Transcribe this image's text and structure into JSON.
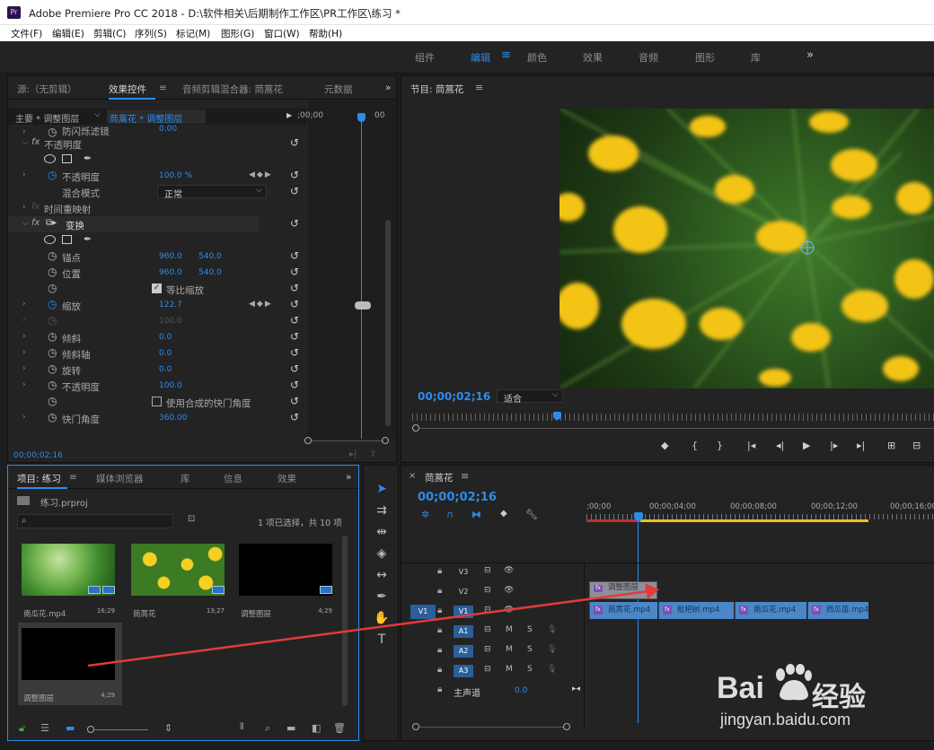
{
  "window": {
    "title": "Adobe Premiere Pro CC 2018 - D:\\软件相关\\后期制作工作区\\PR工作区\\练习 *",
    "app_icon": "Pr"
  },
  "menu": [
    "文件(F)",
    "编辑(E)",
    "剪辑(C)",
    "序列(S)",
    "标记(M)",
    "图形(G)",
    "窗口(W)",
    "帮助(H)"
  ],
  "workspaces": {
    "items": [
      "组件",
      "编辑",
      "颜色",
      "效果",
      "音频",
      "图形",
      "库"
    ],
    "active": "编辑",
    "more": "»"
  },
  "effect_panel": {
    "tabs": [
      "源:（无剪辑）",
      "效果控件",
      "音频剪辑混合器: 茼蒿花",
      "元数据"
    ],
    "master": "主要 * 调整图层",
    "clip": "茼蒿花 * 调整图层",
    "tl_time0": ";00;00",
    "tl_time1": "00",
    "rows": {
      "anti_flicker": "防闪烁滤镜",
      "anti_flicker_val": "0.00",
      "opacity_fx": "不透明度",
      "opacity": "不透明度",
      "opacity_val": "100.0 %",
      "blend": "混合模式",
      "blend_val": "正常",
      "timeremap": "时间重映射",
      "transform_fx": "变换",
      "anchor": "锚点",
      "anchor_x": "960.0",
      "anchor_y": "540.0",
      "position": "位置",
      "position_x": "960.0",
      "position_y": "540.0",
      "uniform": "等比缩放",
      "scale": "缩放",
      "scale_val": "122.7",
      "scale_w_val": "100.0",
      "skew": "倾斜",
      "skew_val": "0.0",
      "skew_axis": "倾斜轴",
      "skew_axis_val": "0.0",
      "rotation": "旋转",
      "rotation_val": "0.0",
      "opacity2": "不透明度",
      "opacity2_val": "100.0",
      "comp_shutter": "使用合成的快门角度",
      "shutter": "快门角度",
      "shutter_val": "360.00"
    },
    "timecode": "00;00;02;16"
  },
  "program": {
    "title": "节目: 茼蒿花",
    "timecode": "00;00;02;16",
    "fit": "适合"
  },
  "project": {
    "tabs": [
      "项目: 练习",
      "媒体浏览器",
      "库",
      "信息",
      "效果"
    ],
    "file": "练习.prproj",
    "selection": "1 项已选择，共 10 项",
    "items": [
      {
        "name": "南瓜花.mp4",
        "dur": "16;29"
      },
      {
        "name": "茼蒿花",
        "dur": "13;27"
      },
      {
        "name": "调整图层",
        "dur": "4;29"
      },
      {
        "name": "调整图层",
        "dur": "4;29"
      }
    ]
  },
  "timeline": {
    "title": "茼蒿花",
    "timecode": "00;00;02;16",
    "ruler": [
      ";00;00",
      "00;00;04;00",
      "00;00;08;00",
      "00;00;12;00",
      "00;00;16;00"
    ],
    "tracks": {
      "v3": "V3",
      "v2": "V2",
      "v1": "V1",
      "src_v": "V1",
      "a1": "A1",
      "a2": "A2",
      "a3": "A3",
      "m": "M",
      "s": "S",
      "master": "主声道",
      "master_val": "0.0"
    },
    "adjust_clip": "调整图层",
    "clips": [
      "茼蒿花.mp4",
      "枇杷树.mp4",
      "南瓜花.mp4",
      "西瓜苗.mp4"
    ]
  },
  "watermark": {
    "brand": "Bai",
    "brand2": "经验",
    "url": "jingyan.baidu.com"
  }
}
